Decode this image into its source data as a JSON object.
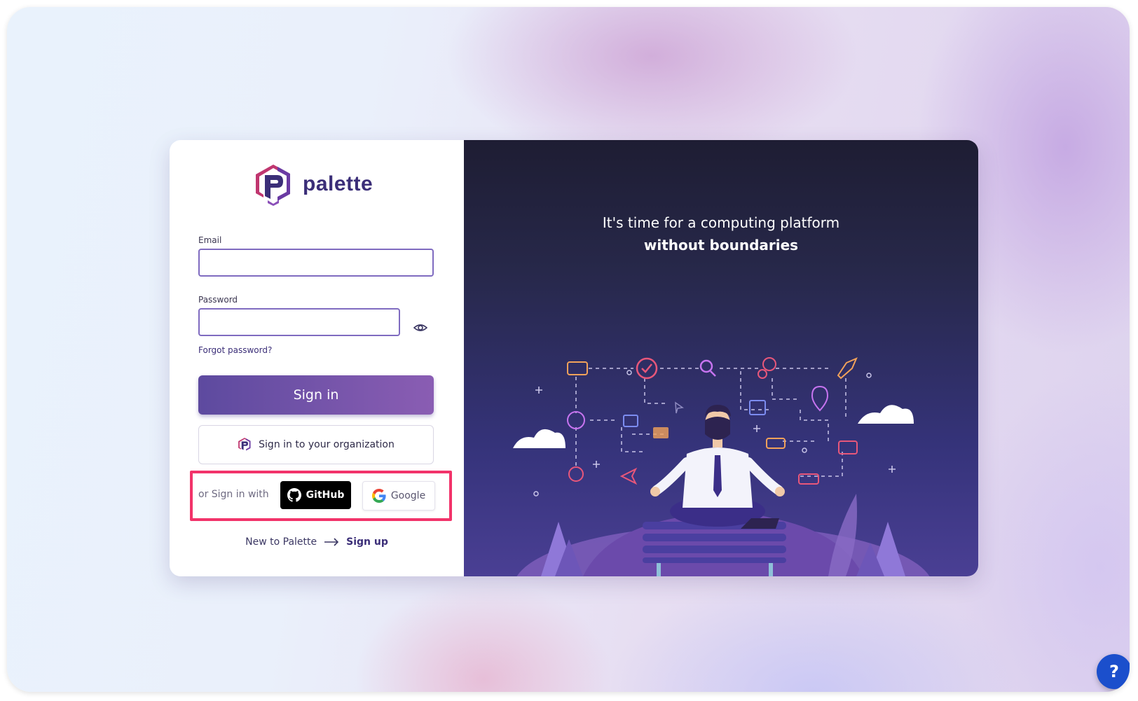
{
  "brand": {
    "name": "palette",
    "primary_color": "#3b2e78",
    "accent_color": "#7b57b0"
  },
  "form": {
    "email_label": "Email",
    "email_value": "",
    "password_label": "Password",
    "password_value": "",
    "forgot_label": "Forgot password?",
    "signin_label": "Sign in",
    "org_signin_label": "Sign in to your organization"
  },
  "social": {
    "or_label": "or Sign in with",
    "github_label": "GitHub",
    "google_label": "Google"
  },
  "signup": {
    "prompt": "New to Palette",
    "link_label": "Sign up"
  },
  "hero": {
    "line1": "It's time for a computing platform",
    "line2": "without boundaries"
  },
  "help": {
    "label": "?"
  },
  "icons": [
    "palette-logo-icon",
    "eye-icon",
    "github-icon",
    "google-icon",
    "arrow-right-icon",
    "help-icon"
  ],
  "highlight_color": "#f2336a"
}
